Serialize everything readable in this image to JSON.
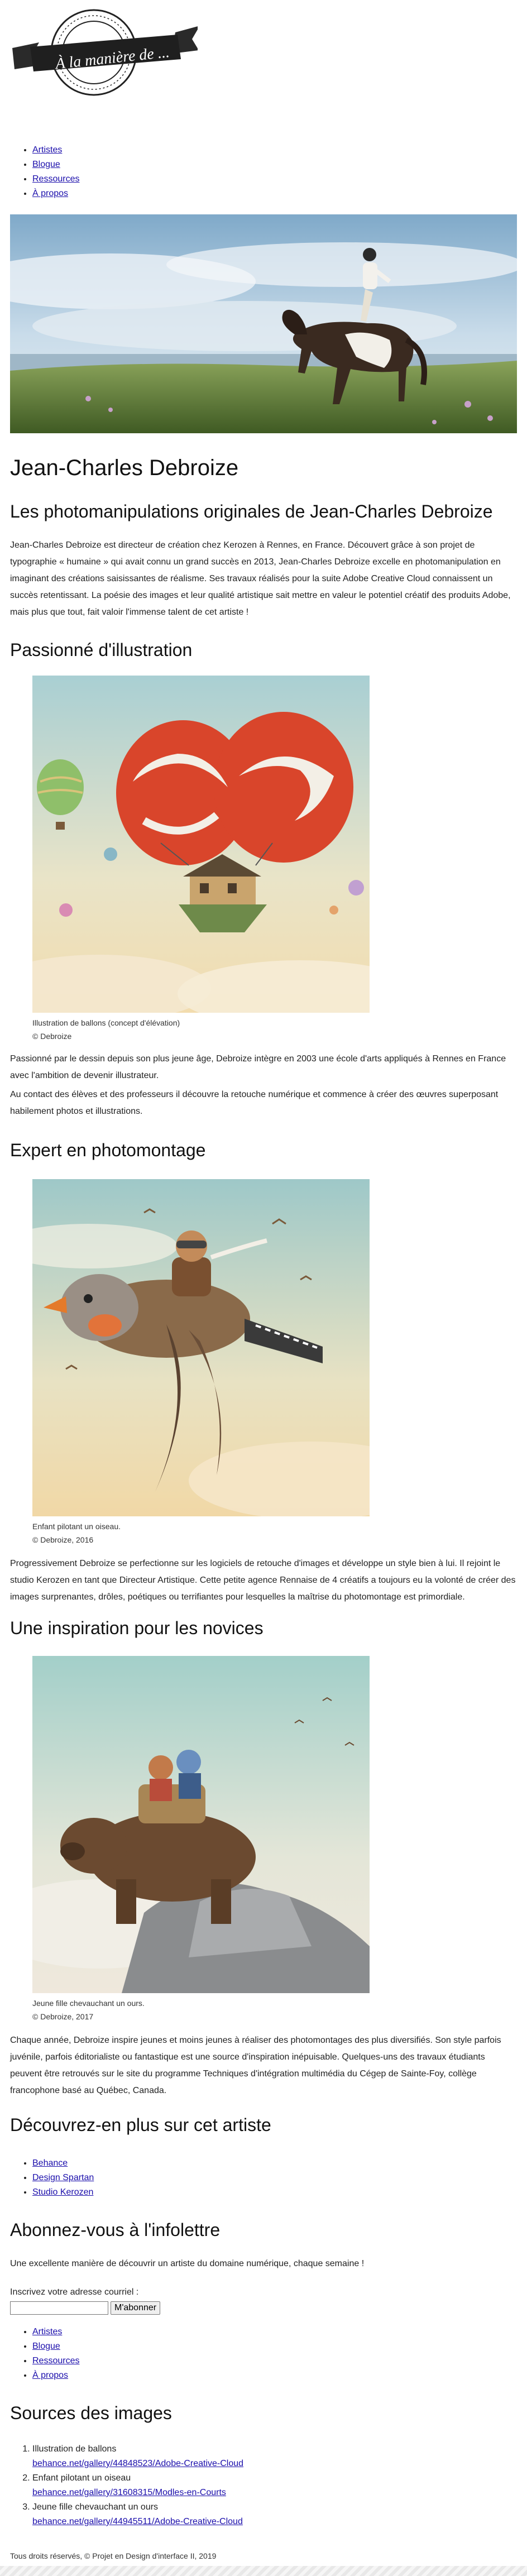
{
  "logo": {
    "text": "À la manière de ..."
  },
  "nav": [
    "Artistes",
    "Blogue",
    "Ressources",
    "À propos"
  ],
  "hero": {
    "alt": "Cavalière sur un cheval dans un paysage"
  },
  "article": {
    "title": "Jean-Charles Debroize",
    "subtitle": "Les photomanipulations originales de Jean-Charles Debroize",
    "intro": "Jean-Charles Debroize est directeur de création chez Kerozen à Rennes, en France. Découvert grâce à son projet de typographie « humaine » qui avait connu un grand succès en 2013, Jean-Charles Debroize excelle en photomanipulation en imaginant des créations saisissantes de réalisme. Ses travaux réalisés pour la suite Adobe Creative Cloud connaissent un succès retentissant. La poésie des images et leur qualité artistique sait mettre en valeur le potentiel créatif des produits Adobe, mais plus que tout, fait valoir l'immense talent de cet artiste !",
    "section1": {
      "heading": "Passionné d'illustration",
      "caption_line1": "Illustration de ballons (concept d'élévation)",
      "caption_line2": "© Debroize",
      "p1": "Passionné par le dessin depuis son plus jeune âge, Debroize intègre en 2003 une école d'arts appliqués à Rennes en France avec l'ambition de devenir illustrateur.",
      "p2": "Au contact des élèves et des professeurs il découvre la retouche numérique et commence à créer des œuvres superposant habilement photos et illustrations."
    },
    "section2": {
      "heading": "Expert en photomontage",
      "caption_line1": "Enfant pilotant un oiseau.",
      "caption_line2": "© Debroize, 2016",
      "p1": "Progressivement Debroize se perfectionne sur les logiciels de retouche d'images et développe un style bien à lui. Il rejoint le studio Kerozen en tant que Directeur Artistique. Cette petite agence Rennaise de 4 créatifs a toujours eu la volonté de créer des images surprenantes, drôles, poétiques ou terrifiantes pour lesquelles la maîtrise du photomontage est primordiale."
    },
    "section3": {
      "heading": "Une inspiration pour les novices",
      "caption_line1": "Jeune fille chevauchant un ours.",
      "caption_line2": "© Debroize, 2017",
      "p1": "Chaque année, Debroize inspire jeunes et moins jeunes à réaliser des photomontages des plus diversifiés. Son style parfois juvénile, parfois éditorialiste ou fantastique est une source d'inspiration inépuisable. Quelques-uns des travaux étudiants peuvent être retrouvés sur le site du programme Techniques d'intégration multimédia du Cégep de Sainte-Foy, collège francophone basé au Québec, Canada."
    },
    "discover": {
      "heading": "Découvrez-en plus sur cet artiste",
      "links": [
        "Behance",
        "Design Spartan",
        "Studio Kerozen"
      ]
    }
  },
  "newsletter": {
    "heading": "Abonnez-vous à l'infolettre",
    "text": "Une excellente manière de découvrir un artiste du domaine numérique, chaque semaine !",
    "label": "Inscrivez votre adresse courriel :",
    "input_value": "",
    "button": "M'abonner"
  },
  "sources": {
    "heading": "Sources des images",
    "items": [
      {
        "title": "Illustration de ballons",
        "link": "behance.net/gallery/44848523/Adobe-Creative-Cloud"
      },
      {
        "title": "Enfant pilotant un oiseau",
        "link": "behance.net/gallery/31608315/Modles-en-Courts"
      },
      {
        "title": "Jeune fille chevauchant un ours",
        "link": "behance.net/gallery/44945511/Adobe-Creative-Cloud"
      }
    ]
  },
  "footer": "Tous droits réservés, © Projet en Design d'interface II, 2019",
  "colors": {
    "link": "#1a0dab",
    "text": "#222222",
    "sky": "#b9d6e6",
    "balloon": "#d9452b"
  }
}
